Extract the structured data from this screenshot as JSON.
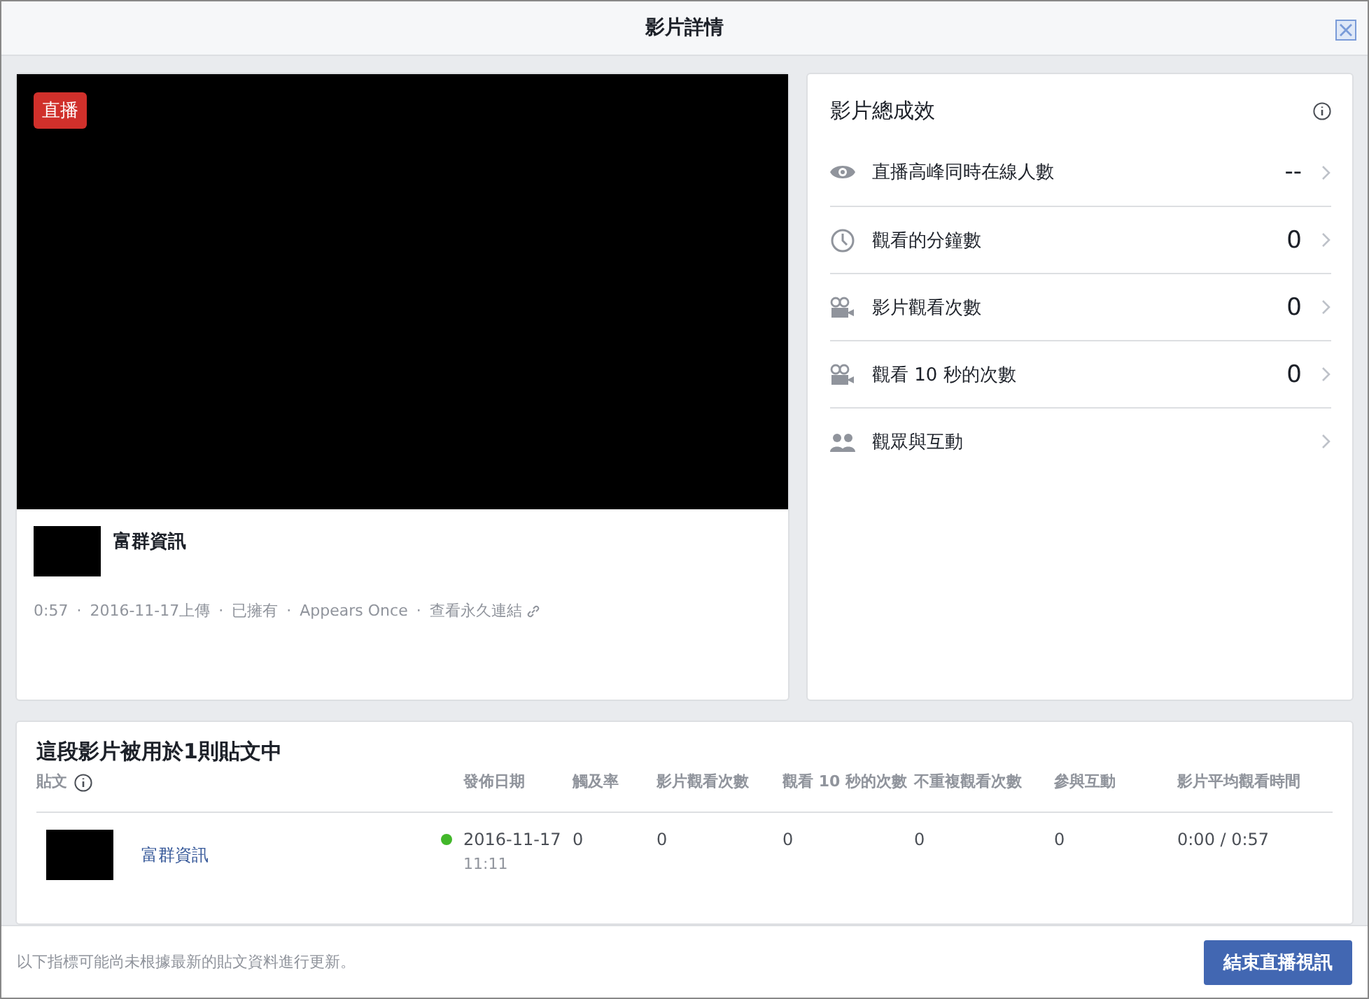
{
  "dialog": {
    "title": "影片詳情"
  },
  "video": {
    "badge": "直播",
    "page_name": "富群資訊",
    "meta": [
      "0:57",
      "·",
      "2016-11-17上傳",
      "·",
      "已擁有",
      "·",
      "Appears Once",
      "·"
    ],
    "permalink": "查看永久連結"
  },
  "metrics": {
    "title": "影片總成效",
    "rows": [
      {
        "kind": "eye",
        "label": "直播高峰同時在線人數",
        "value": "--"
      },
      {
        "kind": "clock",
        "label": "觀看的分鐘數",
        "value": "0"
      },
      {
        "kind": "camera",
        "label": "影片觀看次數",
        "value": "0"
      },
      {
        "kind": "camera",
        "label": "觀看 10 秒的次數",
        "value": "0"
      },
      {
        "kind": "people",
        "label": "觀眾與互動"
      }
    ]
  },
  "posts": {
    "title": "這段影片被用於1則貼文中",
    "columns": [
      "貼文",
      "發佈日期",
      "觸及率",
      "影片觀看次數",
      "觀看 10 秒的次數",
      "不重複觀看次數",
      "參與互動",
      "影片平均觀看時間"
    ],
    "rows": [
      {
        "cells": [
          {
            "text": "富群資訊"
          },
          {
            "text": "2016-11-17",
            "sub": "11:11",
            "color": "#42b72a"
          },
          {
            "text": "0"
          },
          {
            "text": "0"
          },
          {
            "text": "0"
          },
          {
            "text": "0"
          },
          {
            "text": "0"
          },
          {
            "text": "0:00 / 0:57"
          }
        ]
      }
    ]
  },
  "footer": {
    "note": "以下指標可能尚未根據最新的貼文資料進行更新。",
    "button": "結束直播視訊"
  }
}
